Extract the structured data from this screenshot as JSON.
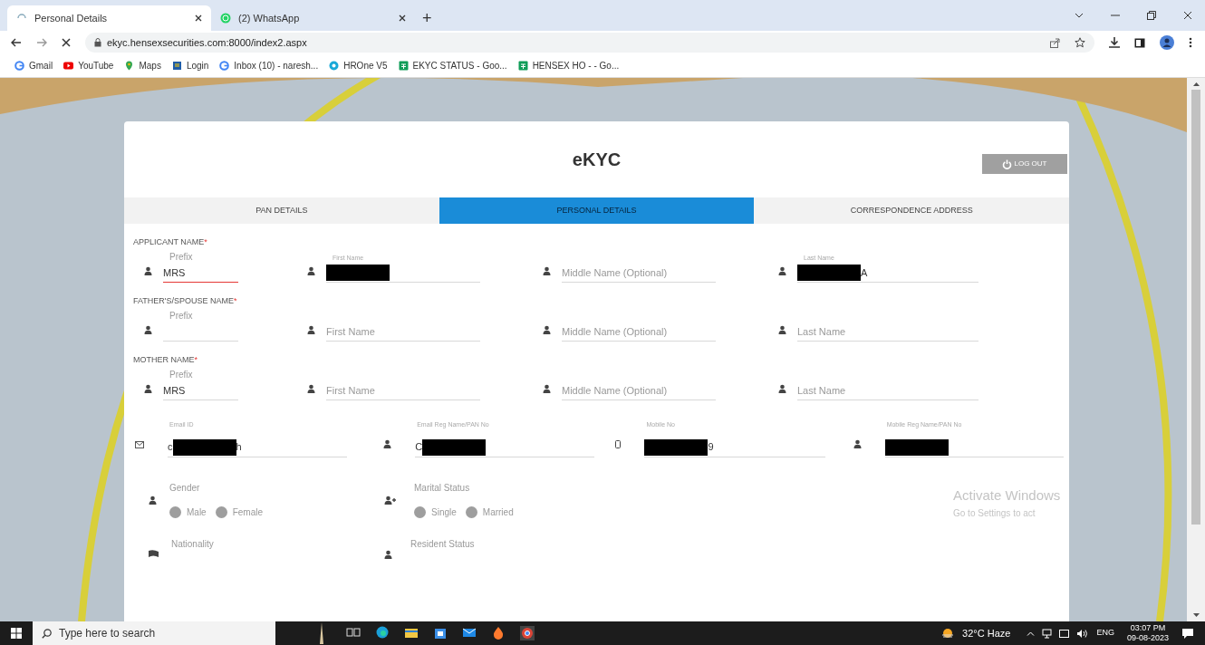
{
  "browser": {
    "tabs": [
      {
        "title": "Personal Details",
        "selected": true,
        "kind": "loading"
      },
      {
        "title": "(2) WhatsApp",
        "selected": false,
        "kind": "whatsapp"
      }
    ],
    "new_tab": "+",
    "url": "ekyc.hensexsecurities.com:8000/index2.aspx",
    "bookmarks": [
      {
        "label": "Gmail",
        "kind": "google"
      },
      {
        "label": "YouTube",
        "kind": "youtube"
      },
      {
        "label": "Maps",
        "kind": "maps"
      },
      {
        "label": "Login",
        "kind": "page"
      },
      {
        "label": "Inbox (10) - naresh...",
        "kind": "google"
      },
      {
        "label": "HROne V5",
        "kind": "hrone"
      },
      {
        "label": "EKYC STATUS - Goo...",
        "kind": "sheets"
      },
      {
        "label": "HENSEX HO - - Go...",
        "kind": "sheets"
      }
    ]
  },
  "page": {
    "title": "eKYC",
    "logout": "LOG OUT",
    "steps": [
      {
        "label": "PAN DETAILS",
        "selected": false
      },
      {
        "label": "PERSONAL DETAILS",
        "selected": true
      },
      {
        "label": "CORRESPONDENCE ADDRESS",
        "selected": false
      }
    ],
    "sections": [
      {
        "label": "APPLICANT NAME",
        "required_mark": "*",
        "fields": [
          {
            "label": "Prefix",
            "value": "MRS",
            "focused": true
          },
          {
            "label": "First Name",
            "redacted": true,
            "focused": false
          },
          {
            "placeholder": "Middle Name (Optional)",
            "focused": false
          },
          {
            "label": "Last Name",
            "redacted": true,
            "text_after": "A",
            "focused": false
          }
        ]
      },
      {
        "label": "FATHER'S/SPOUSE NAME",
        "required_mark": "*",
        "fields": [
          {
            "label": "Prefix",
            "focused": false
          },
          {
            "placeholder": "First Name",
            "focused": false
          },
          {
            "placeholder": "Middle Name (Optional)",
            "focused": false
          },
          {
            "placeholder": "Last Name",
            "focused": false
          }
        ]
      },
      {
        "label": "MOTHER NAME",
        "required_mark": "*",
        "fields": [
          {
            "label": "Prefix",
            "value": "MRS",
            "focused": false
          },
          {
            "placeholder": "First Name",
            "focused": false
          },
          {
            "placeholder": "Middle Name (Optional)",
            "focused": false
          },
          {
            "placeholder": "Last Name",
            "focused": false
          }
        ]
      }
    ],
    "contacts": [
      {
        "kind": "email",
        "label": "Email ID",
        "text_before": "c",
        "redacted": true,
        "text_after": "h"
      },
      {
        "kind": "person",
        "label": "Email Reg Name/PAN No",
        "text_before": "C",
        "redacted": true
      },
      {
        "kind": "mobile",
        "label": "Mobile No",
        "redacted": true,
        "text_after": "9"
      },
      {
        "kind": "person",
        "label": "Mobile Reg Name/PAN No",
        "redacted": true
      }
    ],
    "choices": [
      {
        "kind": "person",
        "label": "Gender",
        "options": [
          {
            "label": "Male",
            "selected": false
          },
          {
            "label": "Female",
            "selected": false
          }
        ]
      },
      {
        "kind": "people",
        "label": "Marital Status",
        "options": [
          {
            "label": "Single",
            "selected": false
          },
          {
            "label": "Married",
            "selected": false
          }
        ]
      }
    ],
    "more_labels": [
      {
        "kind": "flag",
        "label": "Nationality"
      },
      {
        "kind": "person",
        "label": "Resident Status"
      }
    ]
  },
  "activation": {
    "title": "Activate Windows",
    "text": "Go to Settings to act"
  },
  "taskbar": {
    "search": {
      "placeholder": "Type here to search"
    },
    "weather": "32°C Haze",
    "language": "ENG",
    "time": "03:07 PM",
    "date": "09-08-2023"
  }
}
